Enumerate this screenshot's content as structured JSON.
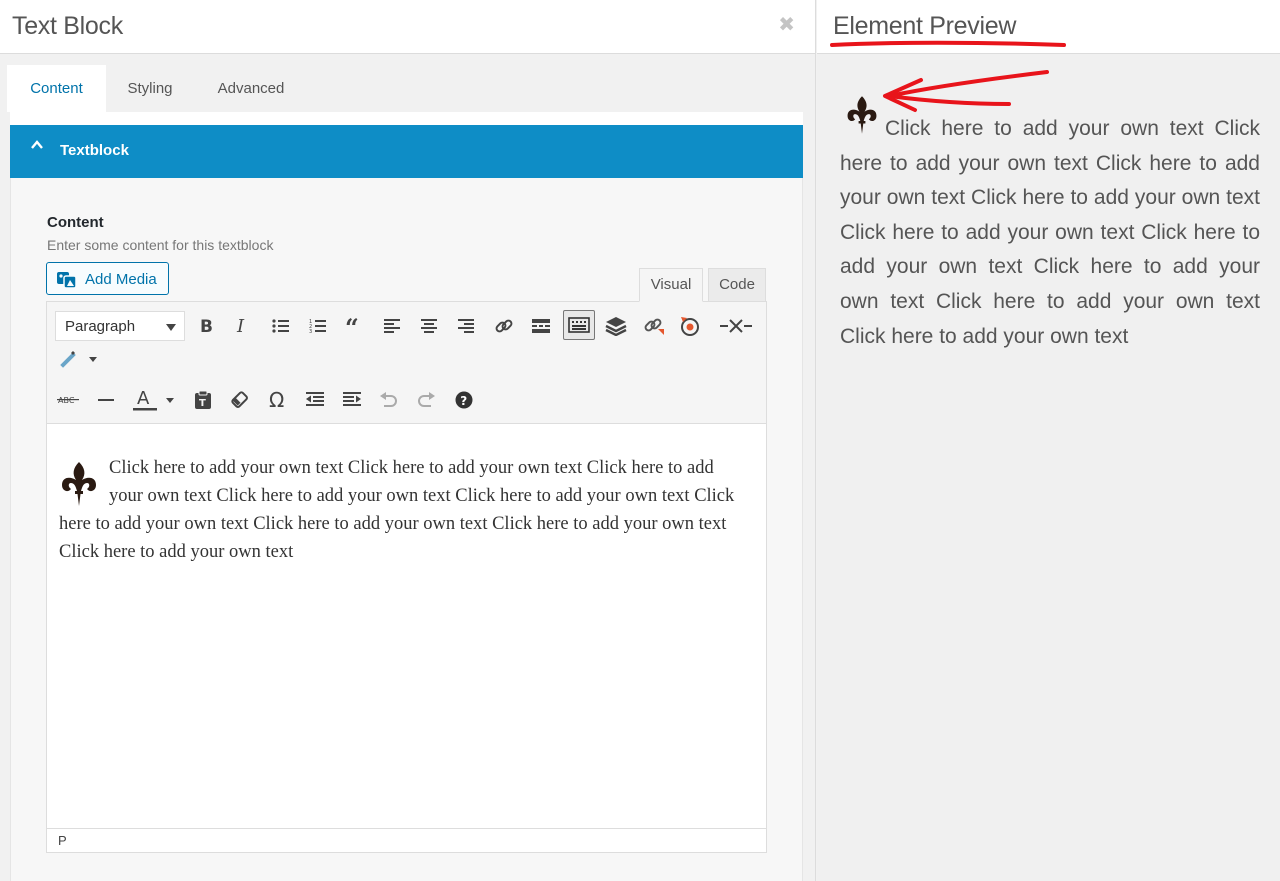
{
  "left_panel": {
    "title": "Text Block",
    "close_icon": "close-icon",
    "tabs": [
      {
        "label": "Content",
        "active": true
      },
      {
        "label": "Styling",
        "active": false
      },
      {
        "label": "Advanced",
        "active": false
      }
    ],
    "section": {
      "label": "Textblock",
      "icon": "chevron-up-icon"
    },
    "field": {
      "label": "Content",
      "description": "Enter some content for this textblock"
    },
    "add_media_label": "Add Media",
    "editor_modes": {
      "visual": "Visual",
      "code": "Code",
      "active": "Visual"
    },
    "format_select": {
      "selected": "Paragraph"
    },
    "toolbar_row1": [
      "bold-icon",
      "italic-icon",
      "bulleted-list-icon",
      "numbered-list-icon",
      "blockquote-icon",
      "align-left-icon",
      "align-center-icon",
      "align-right-icon",
      "insert-link-icon",
      "read-more-icon",
      "toolbar-toggle-icon",
      "layers-icon",
      "unlink-icon",
      "target-icon",
      "split-icon",
      "magic-wand-icon"
    ],
    "toolbar_row2": [
      "strikethrough-icon",
      "horizontal-line-icon",
      "text-color-icon",
      "paste-as-text-icon",
      "clear-formatting-icon",
      "special-character-icon",
      "outdent-icon",
      "indent-icon",
      "undo-icon",
      "redo-icon",
      "help-icon"
    ],
    "strike_label": "ABC",
    "text_color_label": "A",
    "omega_label": "Ω",
    "editor_content": "Click here to add your own text Click here to add your own text Click here to add your own text Click here to add your own text Click here to add your own text Click here to add your own text Click here to add your own text Click here to add your own text Click here to add your own text",
    "statusbar_path": "P"
  },
  "right_panel": {
    "title": "Element Preview",
    "preview_text": "Click here to add your own text Click here to add your own text Click here to add your own text Click here to add your own text Click here to add your own text Click here to add your own text Click here to add your own text Click here to add your own text Click here to add your own text",
    "annotation_color": "#e8141b"
  },
  "colors": {
    "accent": "#0073aa",
    "section_bar": "#0e8dc6"
  }
}
